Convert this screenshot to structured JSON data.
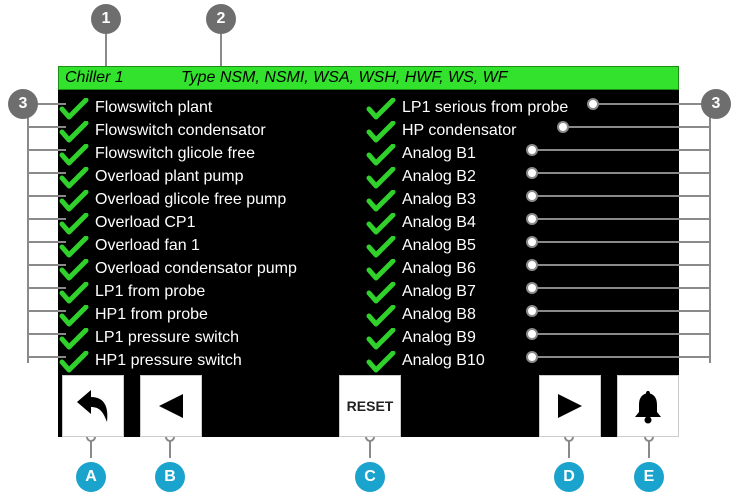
{
  "title_bar": {
    "chiller": "Chiller 1",
    "type": "Type NSM, NSMI, WSA, WSH, HWF, WS, WF"
  },
  "left_items": [
    "Flowswitch plant",
    "Flowswitch condensator",
    "Flowswitch glicole free",
    "Overload plant pump",
    "Overload glicole free pump",
    "Overload CP1",
    "Overload fan 1",
    "Overload condensator pump",
    "LP1 from probe",
    "HP1 from probe",
    "LP1 pressure switch",
    "HP1 pressure switch"
  ],
  "right_items": [
    "LP1 serious from probe",
    "HP condensator",
    "Analog B1",
    "Analog B2",
    "Analog B3",
    "Analog B4",
    "Analog B5",
    "Analog B6",
    "Analog B7",
    "Analog B8",
    "Analog B9",
    "Analog B10"
  ],
  "buttons": {
    "back_icon": "back-arrow-icon",
    "prev_icon": "left-triangle-icon",
    "reset_label": "RESET",
    "next_icon": "right-triangle-icon",
    "alarm_icon": "bell-icon"
  },
  "callouts": {
    "c1": "1",
    "c2": "2",
    "c3": "3",
    "A": "A",
    "B": "B",
    "C": "C",
    "D": "D",
    "E": "E"
  },
  "colors": {
    "title_green": "#33e22d",
    "check_green": "#2fd12a",
    "callout_gray": "#6e6e6e",
    "callout_blue": "#1aa3cc"
  }
}
